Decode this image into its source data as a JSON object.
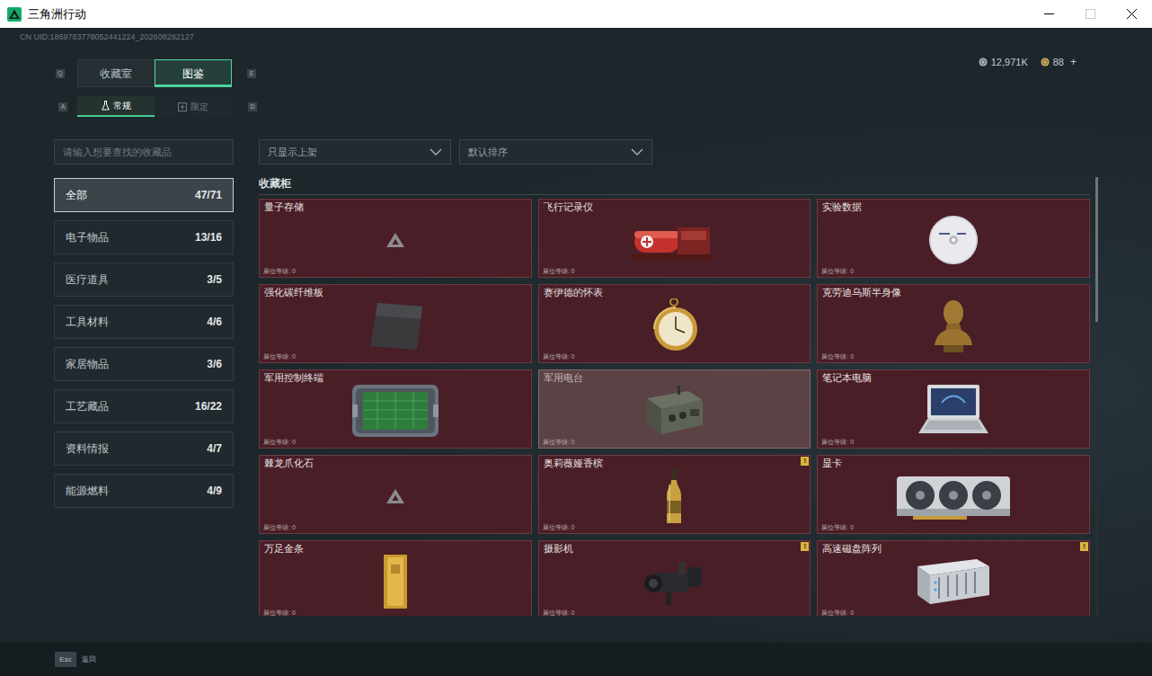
{
  "window": {
    "title": "三角洲行动",
    "maximize_disabled": true
  },
  "uid": "CN UID:1869783778052441224_202608282127",
  "currency": [
    {
      "amount": "12,971K",
      "kind": "silver"
    },
    {
      "amount": "88",
      "kind": "gold"
    }
  ],
  "currency_add": "+",
  "tabs": {
    "prev_key": "Q",
    "next_key": "E",
    "items": [
      {
        "label": "收藏室",
        "selected": false
      },
      {
        "label": "图鉴",
        "selected": true
      }
    ]
  },
  "subtabs": {
    "prev_key": "A",
    "next_key": "D",
    "items": [
      {
        "label": "常规",
        "selected": true
      },
      {
        "label": "限定",
        "selected": false
      }
    ]
  },
  "search": {
    "placeholder": "请输入想要查找的收藏品"
  },
  "categories": [
    {
      "label": "全部",
      "count": "47/71",
      "selected": true
    },
    {
      "label": "电子物品",
      "count": "13/16",
      "selected": false
    },
    {
      "label": "医疗道具",
      "count": "3/5",
      "selected": false
    },
    {
      "label": "工具材料",
      "count": "4/6",
      "selected": false
    },
    {
      "label": "家居物品",
      "count": "3/6",
      "selected": false
    },
    {
      "label": "工艺藏品",
      "count": "16/22",
      "selected": false
    },
    {
      "label": "资料情报",
      "count": "4/7",
      "selected": false
    },
    {
      "label": "能源燃料",
      "count": "4/9",
      "selected": false
    }
  ],
  "filters": [
    {
      "value": "只显示上架"
    },
    {
      "value": "默认排序"
    }
  ],
  "section_title": "收藏柜",
  "items": [
    {
      "name": "量子存储",
      "level_label": "展位等级: 0",
      "kind": "locked",
      "highlighted": false
    },
    {
      "name": "飞行记录仪",
      "level_label": "展位等级: 0",
      "kind": "item",
      "highlighted": false
    },
    {
      "name": "实验数据",
      "level_label": "展位等级: 0",
      "kind": "item",
      "highlighted": false
    },
    {
      "name": "强化碳纤维板",
      "level_label": "展位等级: 0",
      "kind": "item",
      "highlighted": false
    },
    {
      "name": "赛伊德的怀表",
      "level_label": "展位等级: 0",
      "kind": "item",
      "highlighted": false
    },
    {
      "name": "克劳迪乌斯半身像",
      "level_label": "展位等级: 0",
      "kind": "item",
      "highlighted": false
    },
    {
      "name": "军用控制终端",
      "level_label": "展位等级: 0",
      "kind": "item",
      "highlighted": false
    },
    {
      "name": "军用电台",
      "level_label": "展位等级: 0",
      "kind": "item",
      "highlighted": true
    },
    {
      "name": "笔记本电脑",
      "level_label": "展位等级: 0",
      "kind": "item",
      "highlighted": false
    },
    {
      "name": "棘龙爪化石",
      "level_label": "展位等级: 0",
      "kind": "locked",
      "highlighted": false
    },
    {
      "name": "奥莉薇娅香槟",
      "level_label": "展位等级: 0",
      "kind": "item",
      "highlighted": false,
      "badge": "!"
    },
    {
      "name": "显卡",
      "level_label": "展位等级: 0",
      "kind": "item",
      "highlighted": false
    },
    {
      "name": "万足金条",
      "level_label": "展位等级: 0",
      "kind": "item",
      "highlighted": false
    },
    {
      "name": "摄影机",
      "level_label": "展位等级: 0",
      "kind": "item",
      "highlighted": false,
      "badge": "!"
    },
    {
      "name": "高速磁盘阵列",
      "level_label": "展位等级: 0",
      "kind": "item",
      "highlighted": false,
      "badge": "!"
    }
  ],
  "scrollbar": {
    "level": 0.33
  },
  "footer": {
    "key": "Esc",
    "label": "返回"
  }
}
